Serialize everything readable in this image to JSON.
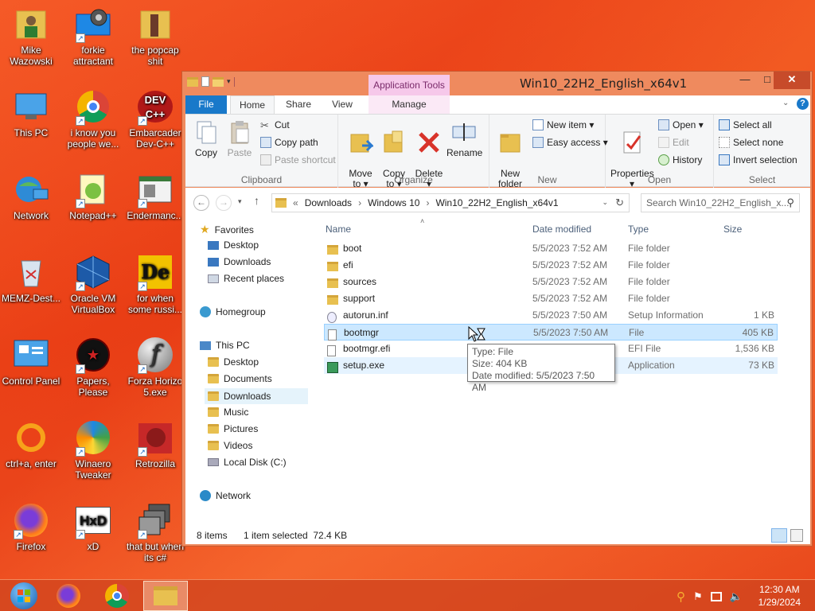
{
  "desktop": {
    "icons": [
      {
        "label": "Mike\nWazowski",
        "icon": "user-folder-icon",
        "shortcut": false
      },
      {
        "label": "forkie\nattractant",
        "icon": "settings-computer-icon",
        "shortcut": true
      },
      {
        "label": "the popcap\nshit",
        "icon": "folder-icon",
        "shortcut": false
      },
      {
        "label": "This PC",
        "icon": "computer-icon",
        "shortcut": false
      },
      {
        "label": "i know you\npeople we...",
        "icon": "chrome-icon",
        "shortcut": true
      },
      {
        "label": "Embarcader\nDev-C++",
        "icon": "devcpp-icon",
        "shortcut": true
      },
      {
        "label": "Network",
        "icon": "network-globe-icon",
        "shortcut": false
      },
      {
        "label": "Notepad++",
        "icon": "notepadpp-icon",
        "shortcut": true
      },
      {
        "label": "Endermanc...",
        "icon": "window-app-icon",
        "shortcut": true
      },
      {
        "label": "MEMZ-Dest...",
        "icon": "recycle-bin-icon",
        "shortcut": false
      },
      {
        "label": "Oracle VM\nVirtualBox",
        "icon": "virtualbox-icon",
        "shortcut": true
      },
      {
        "label": "for when\nsome russi...",
        "icon": "de-icon",
        "shortcut": true
      },
      {
        "label": "Control Panel",
        "icon": "control-panel-icon",
        "shortcut": false
      },
      {
        "label": "Papers, Please",
        "icon": "papers-please-icon",
        "shortcut": true
      },
      {
        "label": "Forza Horizo\n5.exe",
        "icon": "flash-icon",
        "shortcut": true
      },
      {
        "label": "ctrl+a, enter",
        "icon": "ring-icon",
        "shortcut": false
      },
      {
        "label": "Winaero\nTweaker",
        "icon": "winaero-icon",
        "shortcut": true
      },
      {
        "label": "Retrozilla",
        "icon": "retrozilla-icon",
        "shortcut": true
      },
      {
        "label": "Firefox",
        "icon": "firefox-icon",
        "shortcut": true
      },
      {
        "label": "xD",
        "icon": "hxd-icon",
        "shortcut": true
      },
      {
        "label": "that but when\nits c#",
        "icon": "stacked-windows-icon",
        "shortcut": true
      }
    ]
  },
  "window": {
    "title": "Win10_22H2_English_x64v1",
    "context_tab": "Application Tools",
    "tabs": {
      "file": "File",
      "home": "Home",
      "share": "Share",
      "view": "View",
      "manage": "Manage"
    },
    "ribbon": {
      "clipboard": {
        "label": "Clipboard",
        "copy": "Copy",
        "paste": "Paste",
        "cut": "Cut",
        "copy_path": "Copy path",
        "paste_shortcut": "Paste shortcut"
      },
      "organize": {
        "label": "Organize",
        "move_to": "Move\nto ▾",
        "copy_to": "Copy\nto ▾",
        "delete": "Delete\n▾",
        "rename": "Rename"
      },
      "new": {
        "label": "New",
        "new_folder": "New\nfolder",
        "new_item": "New item ▾",
        "easy_access": "Easy access ▾"
      },
      "open": {
        "label": "Open",
        "properties": "Properties\n▾",
        "open": "Open ▾",
        "edit": "Edit",
        "history": "History"
      },
      "select": {
        "label": "Select",
        "select_all": "Select all",
        "select_none": "Select none",
        "invert": "Invert selection"
      }
    },
    "address": {
      "path": [
        "«",
        "Downloads",
        "›",
        "Windows 10",
        "›",
        "Win10_22H2_English_x64v1"
      ],
      "search_placeholder": "Search Win10_22H2_English_x..."
    },
    "nav": {
      "favorites": "Favorites",
      "fav_items": [
        "Desktop",
        "Downloads",
        "Recent places"
      ],
      "homegroup": "Homegroup",
      "this_pc": "This PC",
      "pc_items": [
        "Desktop",
        "Documents",
        "Downloads",
        "Music",
        "Pictures",
        "Videos",
        "Local Disk (C:)"
      ],
      "network": "Network"
    },
    "columns": {
      "name": "Name",
      "date": "Date modified",
      "type": "Type",
      "size": "Size"
    },
    "files": [
      {
        "name": "boot",
        "date": "5/5/2023 7:52 AM",
        "type": "File folder",
        "size": "",
        "kind": "folder"
      },
      {
        "name": "efi",
        "date": "5/5/2023 7:52 AM",
        "type": "File folder",
        "size": "",
        "kind": "folder"
      },
      {
        "name": "sources",
        "date": "5/5/2023 7:52 AM",
        "type": "File folder",
        "size": "",
        "kind": "folder"
      },
      {
        "name": "support",
        "date": "5/5/2023 7:52 AM",
        "type": "File folder",
        "size": "",
        "kind": "folder"
      },
      {
        "name": "autorun.inf",
        "date": "5/5/2023 7:50 AM",
        "type": "Setup Information",
        "size": "1 KB",
        "kind": "inf"
      },
      {
        "name": "bootmgr",
        "date": "5/5/2023 7:50 AM",
        "type": "File",
        "size": "405 KB",
        "kind": "file"
      },
      {
        "name": "bootmgr.efi",
        "date": "",
        "type": "EFI File",
        "size": "1,536 KB",
        "kind": "file"
      },
      {
        "name": "setup.exe",
        "date": "",
        "type": "Application",
        "size": "73 KB",
        "kind": "exe"
      }
    ],
    "tooltip": {
      "line1": "Type: File",
      "line2": "Size: 404 KB",
      "line3": "Date modified: 5/5/2023 7:50 AM"
    },
    "status": {
      "items": "8 items",
      "selection": "1 item selected  72.4 KB"
    }
  },
  "taskbar": {
    "time": "12:30 AM",
    "date": "1/29/2024"
  },
  "colors": {
    "accent": "#1979ca",
    "window_frame": "#ef8a5e",
    "selection": "#cce8ff"
  }
}
